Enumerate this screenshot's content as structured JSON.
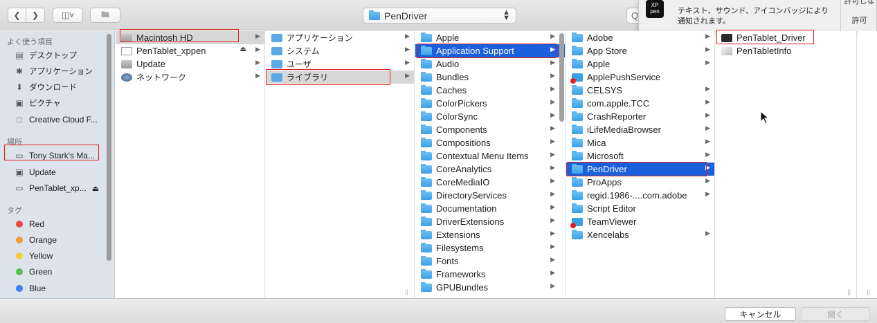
{
  "toolbar": {
    "back_icon": "chevron-left-icon",
    "forward_icon": "chevron-right-icon",
    "view_icon": "column-view-icon",
    "newfolder_icon": "new-folder-icon",
    "location": "PenDriver",
    "search_fragment": "Q"
  },
  "notification": {
    "app_logo": "XP pen",
    "text": "テキスト、サウンド、アイコンバッジにより通知されます。",
    "top_button": "許可しな",
    "allow_button": "許可"
  },
  "sidebar": {
    "favorites_header": "よく使う項目",
    "favorites": [
      {
        "label": "デスクトップ",
        "icon": "desktop-icon"
      },
      {
        "label": "アプリケーション",
        "icon": "applications-icon"
      },
      {
        "label": "ダウンロード",
        "icon": "download-icon"
      },
      {
        "label": "ピクチャ",
        "icon": "pictures-icon"
      },
      {
        "label": "Creative Cloud F...",
        "icon": "folder-icon"
      }
    ],
    "locations_header": "場所",
    "locations": [
      {
        "label": "Tony Stark's Ma...",
        "icon": "computer-icon"
      },
      {
        "label": "Update",
        "icon": "disk-icon"
      },
      {
        "label": "PenTablet_xp...",
        "icon": "disk-icon"
      }
    ],
    "tags_header": "タグ",
    "tags": [
      {
        "label": "Red",
        "color": "#ee4a3e"
      },
      {
        "label": "Orange",
        "color": "#f39a36"
      },
      {
        "label": "Yellow",
        "color": "#f5cd3c"
      },
      {
        "label": "Green",
        "color": "#52c24a"
      },
      {
        "label": "Blue",
        "color": "#3a82f0"
      }
    ]
  },
  "columns": {
    "col1": [
      "Macintosh HD",
      "PenTablet_xppen",
      "Update",
      "ネットワーク"
    ],
    "col2": [
      "アプリケーション",
      "システム",
      "ユーザ",
      "ライブラリ"
    ],
    "col3": [
      "Apple",
      "Application Support",
      "Audio",
      "Bundles",
      "Caches",
      "ColorPickers",
      "ColorSync",
      "Components",
      "Compositions",
      "Contextual Menu Items",
      "CoreAnalytics",
      "CoreMediaIO",
      "DirectoryServices",
      "Documentation",
      "DriverExtensions",
      "Extensions",
      "Filesystems",
      "Fonts",
      "Frameworks",
      "GPUBundles"
    ],
    "col4": [
      "Adobe",
      "App Store",
      "Apple",
      "ApplePushService",
      "CELSYS",
      "com.apple.TCC",
      "CrashReporter",
      "iLifeMediaBrowser",
      "Mica",
      "Microsoft",
      "PenDriver",
      "ProApps",
      "regid.1986-....com.adobe",
      "Script Editor",
      "TeamViewer",
      "Xencelabs"
    ],
    "col5": [
      "PenTablet_Driver",
      "PenTabletInfo"
    ]
  },
  "footer": {
    "cancel": "キャンセル",
    "open": "開く"
  },
  "colors": {
    "selection_blue": "#1a5fdc",
    "highlight_red": "#e0201b"
  }
}
